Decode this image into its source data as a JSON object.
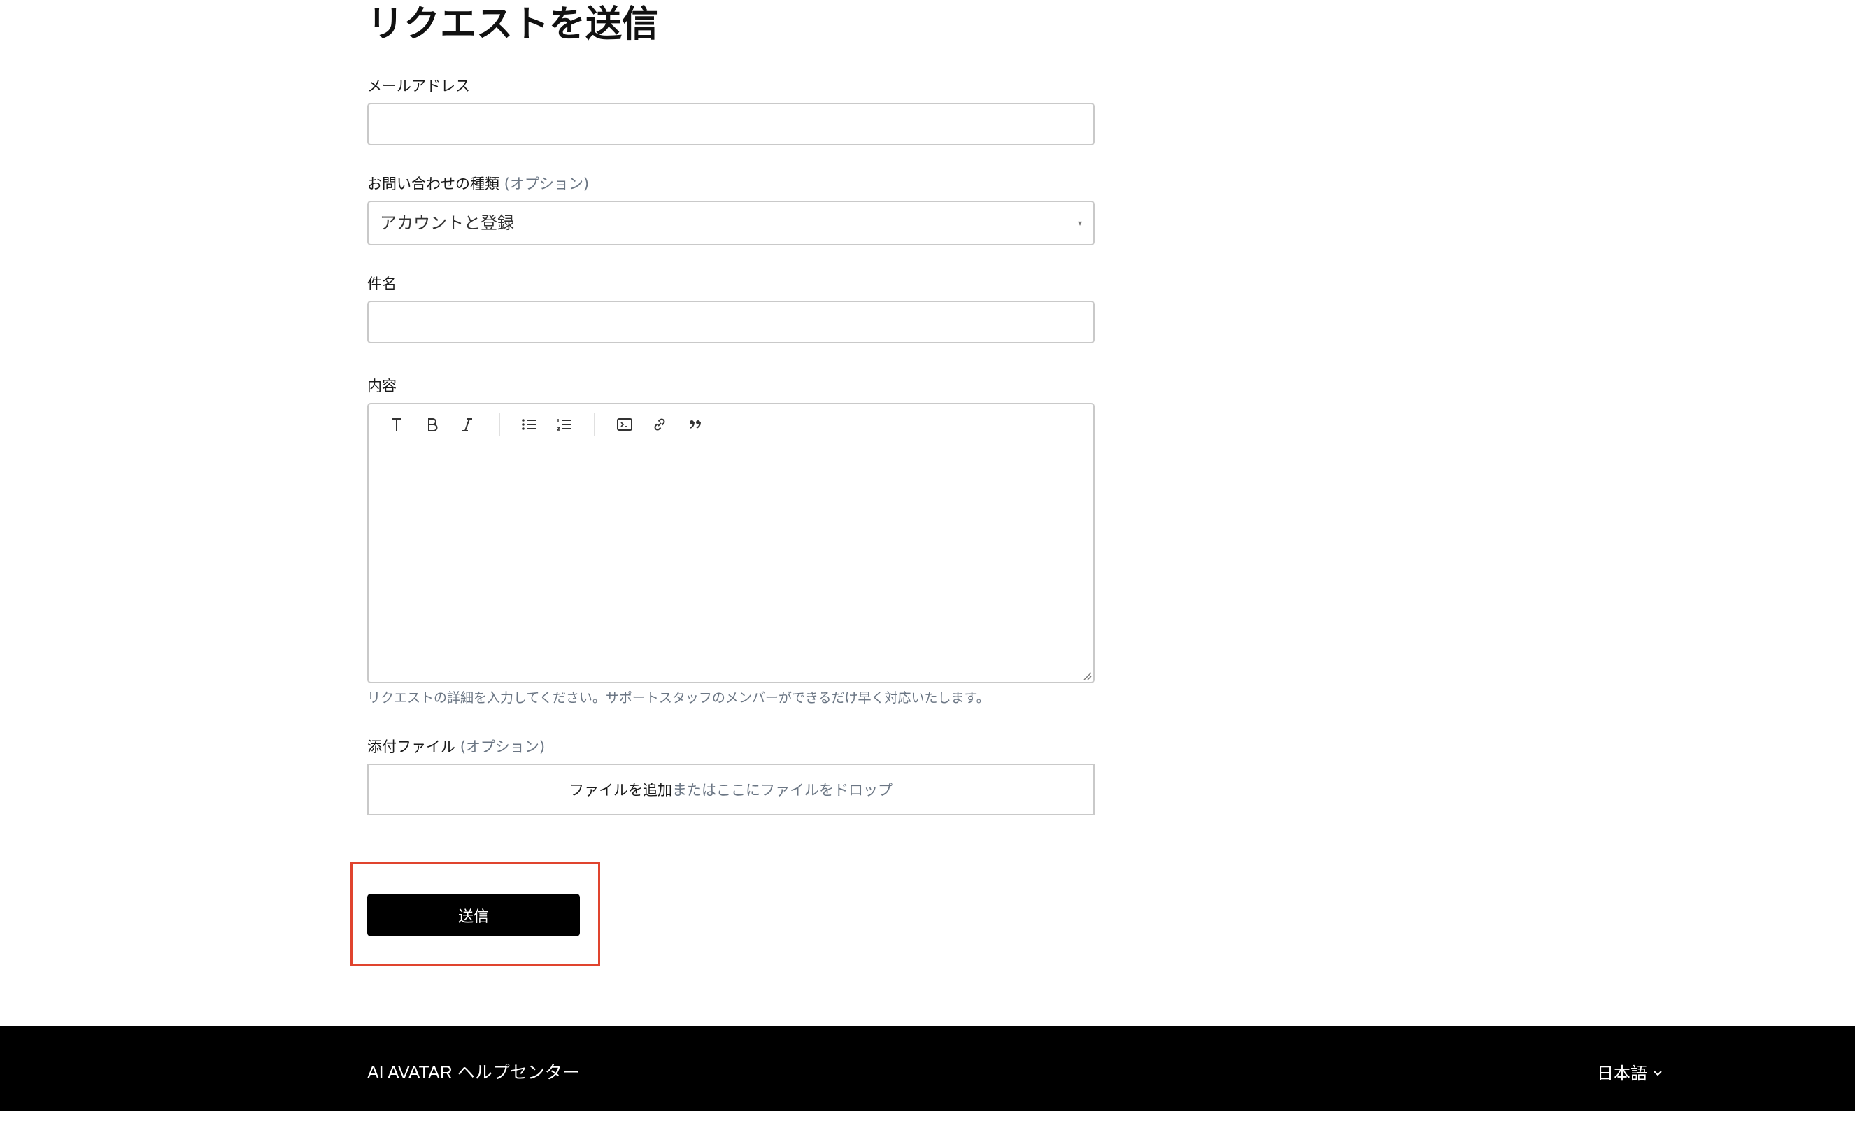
{
  "form": {
    "title": "リクエストを送信",
    "email": {
      "label": "メールアドレス",
      "value": ""
    },
    "inquiry_type": {
      "label": "お問い合わせの種類",
      "optional": "(オプション)",
      "selected": "アカウントと登録"
    },
    "subject": {
      "label": "件名",
      "value": ""
    },
    "content": {
      "label": "内容",
      "toolbar": [
        "text-style",
        "bold",
        "italic",
        "bullet-list",
        "numbered-list",
        "code-block",
        "link",
        "quote"
      ],
      "value": "",
      "hint": "リクエストの詳細を入力してください。サポートスタッフのメンバーができるだけ早く対応いたします。"
    },
    "attachments": {
      "label": "添付ファイル",
      "optional": "(オプション)",
      "add_link": "ファイルを追加",
      "drop_text": "またはここにファイルをドロップ"
    },
    "submit_label": "送信"
  },
  "footer": {
    "title": "AI AVATAR ヘルプセンター",
    "language": "日本語"
  },
  "colors": {
    "highlight_border": "#e0442e",
    "button_bg": "#000000",
    "footer_bg": "#000000",
    "muted_text": "#6b7684"
  }
}
